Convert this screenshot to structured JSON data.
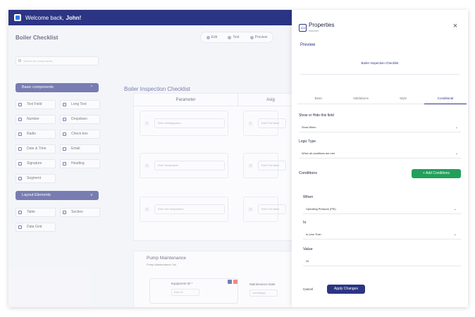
{
  "topbar": {
    "greeting": "Welcome back,",
    "user": "John!"
  },
  "builder": {
    "page_title": "Boiler Checklist",
    "modes": [
      "Edit",
      "Test",
      "Preview"
    ],
    "search_placeholder": "Search for components",
    "basic_header": "Basic components",
    "basic_items": [
      "Text Field",
      "Long Text",
      "Number",
      "Dropdown",
      "Radio",
      "Check box",
      "Date & Time",
      "Email",
      "Signature",
      "Heading",
      "Segment"
    ],
    "layout_header": "Layout Elements",
    "layout_items": [
      "Table",
      "Section",
      "Data Grid"
    ],
    "canvas_title": "Boiler Inspection Checklist",
    "columns": [
      "Parameter",
      "Asig"
    ],
    "rows": [
      {
        "num": "1",
        "left": "Enter Heatingsystem",
        "right": "Enter Full Name"
      },
      {
        "num": "2",
        "left": "Enter Temperature",
        "right": "Enter Full Name"
      },
      {
        "num": "3",
        "left": "Enter Gas Temperature",
        "right": "Enter Full Name"
      }
    ],
    "pump_title": "Pump Maintenance",
    "pump_sub": "Pump Maintenance List",
    "equipment_label": "Equipment ID *",
    "equipment_placeholder": "Enter ID",
    "maintenance_label": "Maintenance Date",
    "maintenance_placeholder": "mm/dd/yyyy"
  },
  "panel": {
    "icon_text": "123",
    "title": "Properties",
    "subtitle": "Number",
    "close": "×",
    "preview_label": "Preview",
    "preview_text": "Boiler Inspection Checklist",
    "tabs": [
      "Basic",
      "Validations",
      "Style",
      "Conditional"
    ],
    "show_hide_label": "Show or Hide this field",
    "show_hide_value": "Show When",
    "logic_label": "Logic Type",
    "logic_value": "When all conditions are met",
    "conditions_label": "Conditions",
    "add_conditions": "+ Add Conditions",
    "when_label": "When",
    "when_value": "Operating Pressure (PSI)",
    "is_label": "Is",
    "is_value": "Is Less Than",
    "value_label": "Value",
    "value_value": "20",
    "cancel": "Cancel",
    "apply": "Apply Changes"
  },
  "colors": {
    "brand": "#2c3484",
    "add_button": "#22a05b"
  }
}
